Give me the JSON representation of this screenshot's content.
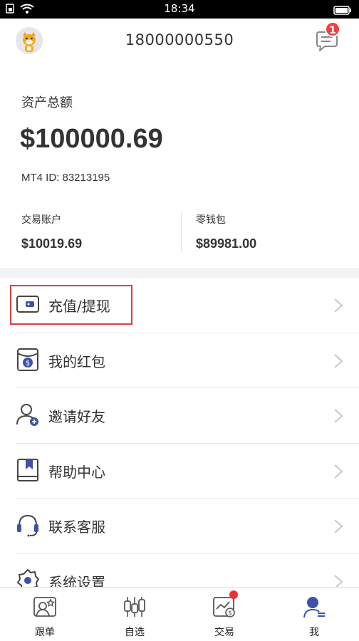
{
  "status_bar": {
    "time": "18:34"
  },
  "header": {
    "phone": "18000000550",
    "message_badge": "1"
  },
  "assets": {
    "label": "资产总额",
    "total": "$100000.69",
    "mt4_id": "MT4 ID: 83213195",
    "trading_account_label": "交易账户",
    "trading_account_value": "$10019.69",
    "wallet_label": "零钱包",
    "wallet_value": "$89981.00"
  },
  "menu": {
    "items": [
      {
        "label": "充值/提现",
        "icon": "wallet-icon"
      },
      {
        "label": "我的红包",
        "icon": "red-packet-icon"
      },
      {
        "label": "邀请好友",
        "icon": "invite-friend-icon"
      },
      {
        "label": "帮助中心",
        "icon": "help-book-icon"
      },
      {
        "label": "联系客服",
        "icon": "headset-icon"
      },
      {
        "label": "系统设置",
        "icon": "gear-icon"
      }
    ]
  },
  "tabs": [
    {
      "label": "跟单",
      "icon": "follow-icon"
    },
    {
      "label": "自选",
      "icon": "candlestick-icon"
    },
    {
      "label": "交易",
      "icon": "trade-icon"
    },
    {
      "label": "我",
      "icon": "profile-icon",
      "active": true
    }
  ],
  "colors": {
    "accent": "#3d52a8",
    "badge": "#f0413f",
    "highlight_border": "#e23b3b"
  }
}
